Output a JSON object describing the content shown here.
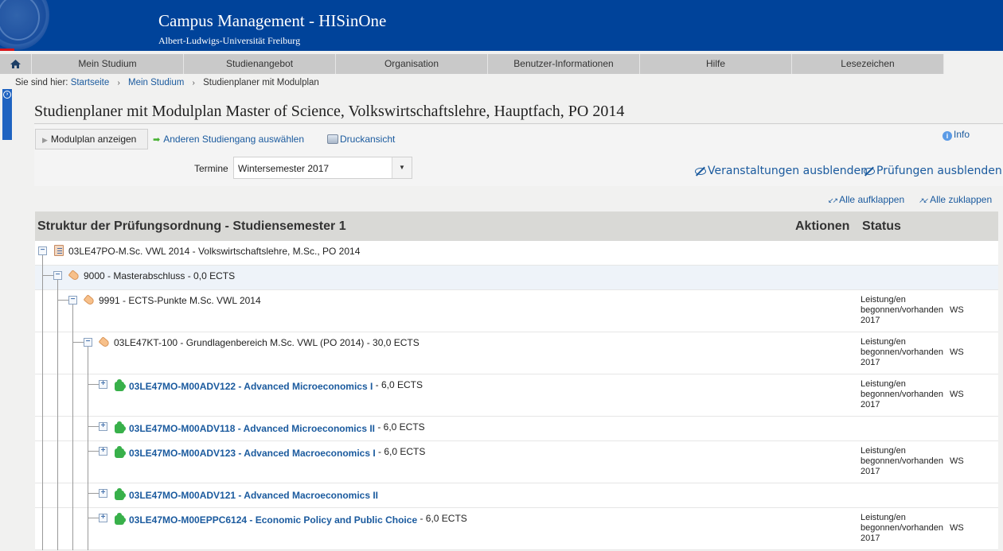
{
  "header": {
    "title": "Campus Management - HISinOne",
    "subtitle": "Albert-Ludwigs-Universität Freiburg"
  },
  "nav": {
    "home_icon": "home-icon",
    "items": [
      "Mein Studium",
      "Studienangebot",
      "Organisation",
      "Benutzer-Informationen",
      "Hilfe",
      "Lesezeichen"
    ]
  },
  "breadcrumb": {
    "label": "Sie sind hier:",
    "items": [
      "Startseite",
      "Mein Studium",
      "Studienplaner mit Modulplan"
    ]
  },
  "page": {
    "title": "Studienplaner mit Modulplan Master of Science, Volkswirtschaftslehre, Hauptfach, PO 2014"
  },
  "toolbar": {
    "modulplan_button": "Modulplan anzeigen",
    "anderen_link": "Anderen Studiengang auswählen",
    "druck_link": "Druckansicht",
    "info_link": "Info",
    "termine_label": "Termine",
    "termine_value": "Wintersemester 2017",
    "veranstaltungen_link": "Veranstaltungen ausblenden",
    "pruefungen_link": "Prüfungen ausblenden",
    "alle_auf": "Alle aufklappen",
    "alle_zu": "Alle zuklappen"
  },
  "table": {
    "headers": {
      "struktur": "Struktur der Prüfungsordnung - Studiensemester 1",
      "aktionen": "Aktionen",
      "status": "Status"
    },
    "rows": [
      {
        "text": "03LE47PO-M.Sc. VWL 2014 - Volkswirtschaftslehre, M.Sc., PO 2014",
        "icon": "book-icon",
        "toggle": "−"
      },
      {
        "text": "9000 - Masterabschluss - 0,0 ECTS",
        "icon": "tag-icon",
        "toggle": "−"
      },
      {
        "text": "9991 - ECTS-Punkte M.Sc. VWL 2014",
        "icon": "tag-icon",
        "toggle": "−",
        "status": {
          "line1": "Leistung/en",
          "line2": "begonnen/vorhanden",
          "term": "WS",
          "year": "2017"
        }
      },
      {
        "text": "03LE47KT-100 - Grundlagenbereich M.Sc. VWL (PO 2014) - 30,0 ECTS",
        "icon": "tag-icon",
        "toggle": "−",
        "status": {
          "line1": "Leistung/en",
          "line2": "begonnen/vorhanden",
          "term": "WS",
          "year": "2017"
        }
      },
      {
        "link": "03LE47MO-M00ADV122 - Advanced Microeconomics I",
        "suffix": " - 6,0 ECTS",
        "icon": "puzzle-icon",
        "toggle": "+",
        "status": {
          "line1": "Leistung/en",
          "line2": "begonnen/vorhanden",
          "term": "WS",
          "year": "2017"
        }
      },
      {
        "link": "03LE47MO-M00ADV118 - Advanced Microeconomics II",
        "suffix": " - 6,0 ECTS",
        "icon": "puzzle-icon",
        "toggle": "+"
      },
      {
        "link": "03LE47MO-M00ADV123 - Advanced Macroeconomics I",
        "suffix": " - 6,0 ECTS",
        "icon": "puzzle-icon",
        "toggle": "+",
        "status": {
          "line1": "Leistung/en",
          "line2": "begonnen/vorhanden",
          "term": "WS",
          "year": "2017"
        }
      },
      {
        "link": "03LE47MO-M00ADV121 - Advanced Macroeconomics II",
        "suffix": "",
        "icon": "puzzle-icon",
        "toggle": "+"
      },
      {
        "link": "03LE47MO-M00EPPC6124 - Economic Policy and Public Choice",
        "suffix": " - 6,0 ECTS",
        "icon": "puzzle-icon",
        "toggle": "+",
        "status": {
          "line1": "Leistung/en",
          "line2": "begonnen/vorhanden",
          "term": "WS",
          "year": "2017"
        }
      }
    ]
  }
}
